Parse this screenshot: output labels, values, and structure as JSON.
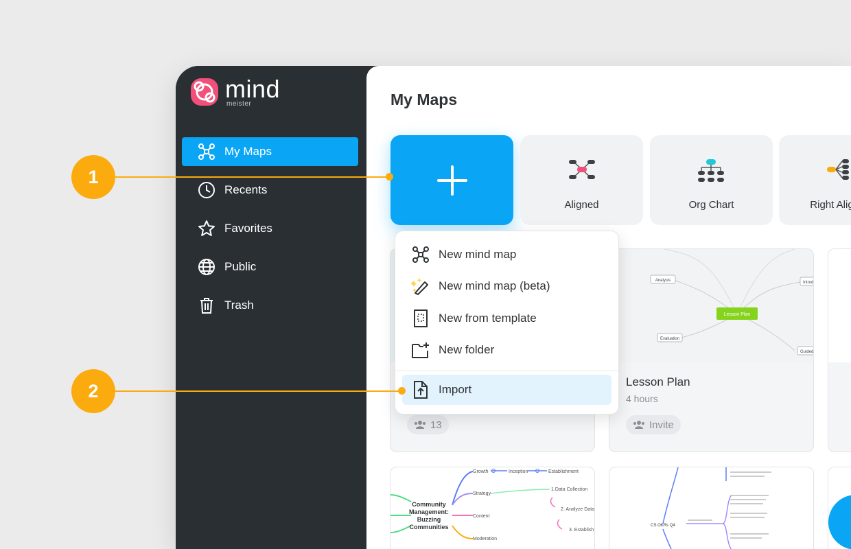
{
  "logo": {
    "word": "mind",
    "sub": "meister"
  },
  "sidebar": {
    "items": [
      {
        "label": "My Maps",
        "icon": "mindmap-icon",
        "active": true
      },
      {
        "label": "Recents",
        "icon": "clock-icon"
      },
      {
        "label": "Favorites",
        "icon": "star-icon"
      },
      {
        "label": "Public",
        "icon": "globe-icon"
      },
      {
        "label": "Trash",
        "icon": "trash-icon"
      }
    ]
  },
  "main": {
    "title": "My Maps",
    "templates": [
      {
        "label": "Aligned"
      },
      {
        "label": "Org Chart"
      },
      {
        "label": "Right Aligned"
      }
    ],
    "cards": [
      {
        "title": "",
        "sub": "",
        "members": "13"
      },
      {
        "title": "Lesson Plan",
        "sub": "4 hours",
        "invite": "Invite",
        "thumb": {
          "center": "Lesson Plan",
          "nodes": [
            "Analysis",
            "Evaluation",
            "Introd",
            "Guided"
          ]
        }
      }
    ],
    "bottom_card": {
      "center": "Community Management: Buzzing Communities",
      "branches": [
        "Growth",
        "Strategy",
        "Content",
        "Moderation"
      ],
      "chain": [
        "Inception",
        "Establishment"
      ],
      "steps": [
        "1.Data Collection",
        "2. Analyze Data",
        "3. Establish"
      ]
    },
    "bottom_card2": {
      "center": "CS OKRs Q4"
    }
  },
  "menu": {
    "items": [
      {
        "label": "New mind map",
        "icon": "mindmap-icon"
      },
      {
        "label": "New mind map (beta)",
        "icon": "magic-wand-icon"
      },
      {
        "label": "New from template",
        "icon": "template-icon"
      },
      {
        "label": "New folder",
        "icon": "new-folder-icon"
      },
      {
        "label": "Import",
        "icon": "import-icon"
      }
    ]
  },
  "callouts": [
    "1",
    "2"
  ],
  "colors": {
    "accent": "#0aa6f5",
    "sidebar": "#2a2f34",
    "callout": "#fcab0f",
    "brand": "#f0507a"
  }
}
